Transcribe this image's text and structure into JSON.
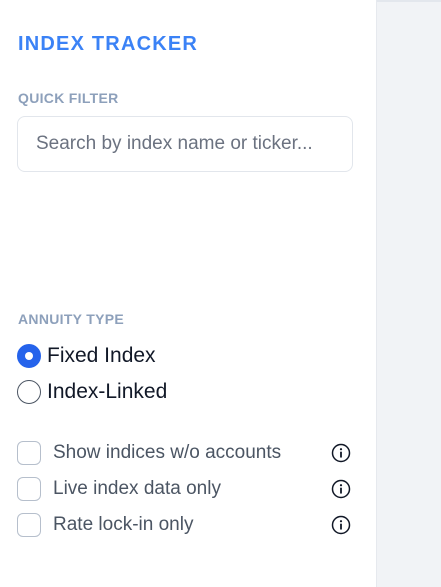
{
  "app": {
    "title": "INDEX TRACKER"
  },
  "quick_filter": {
    "label": "QUICK FILTER",
    "search_placeholder": "Search by index name or ticker..."
  },
  "annuity_type": {
    "label": "ANNUITY TYPE",
    "options": [
      {
        "label": "Fixed Index",
        "selected": true
      },
      {
        "label": "Index-Linked",
        "selected": false
      }
    ]
  },
  "toggles": [
    {
      "label": "Show indices w/o accounts",
      "checked": false,
      "icon": "info-icon"
    },
    {
      "label": "Live index data only",
      "checked": false,
      "icon": "info-icon"
    },
    {
      "label": "Rate lock-in only",
      "checked": false,
      "icon": "info-icon"
    }
  ],
  "colors": {
    "accent": "#3b82f6",
    "radio_selected": "#2563eb",
    "section_label": "#8da0bb"
  }
}
